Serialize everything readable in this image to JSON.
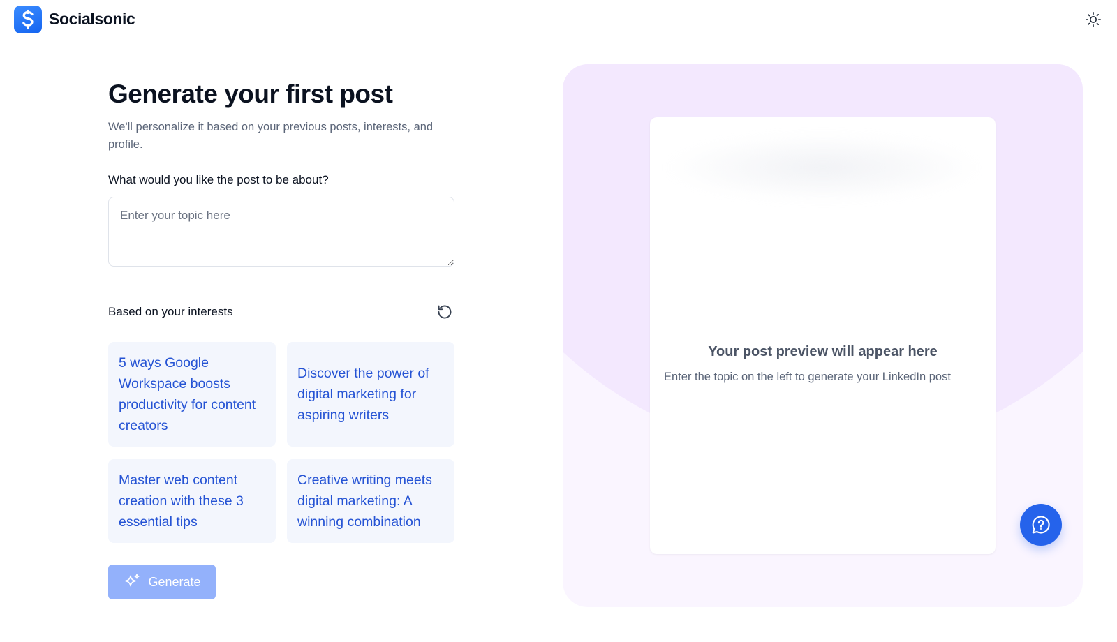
{
  "app": {
    "name": "Socialsonic",
    "logo_icon": "socialsonic-s-logo",
    "theme_icon": "sun-icon",
    "accent_color": "#2563eb"
  },
  "form": {
    "heading": "Generate your first post",
    "subtitle": "We'll personalize it based on your previous posts, interests, and profile.",
    "topic_label": "What would you like the post to be about?",
    "topic_placeholder": "Enter your topic here",
    "topic_value": "",
    "interests_label": "Based on your interests",
    "refresh_icon": "refresh-icon",
    "suggestions": [
      "5 ways Google Workspace boosts productivity for content creators",
      "Discover the power of digital marketing for aspiring writers",
      "Master web content creation with these 3 essential tips",
      "Creative writing meets digital marketing: A winning combination"
    ],
    "generate_label": "Generate",
    "generate_icon": "sparkles-icon"
  },
  "preview": {
    "title": "Your post preview will appear here",
    "description": "Enter the topic on the left to generate your LinkedIn post"
  },
  "help": {
    "icon": "help-chat-icon"
  }
}
